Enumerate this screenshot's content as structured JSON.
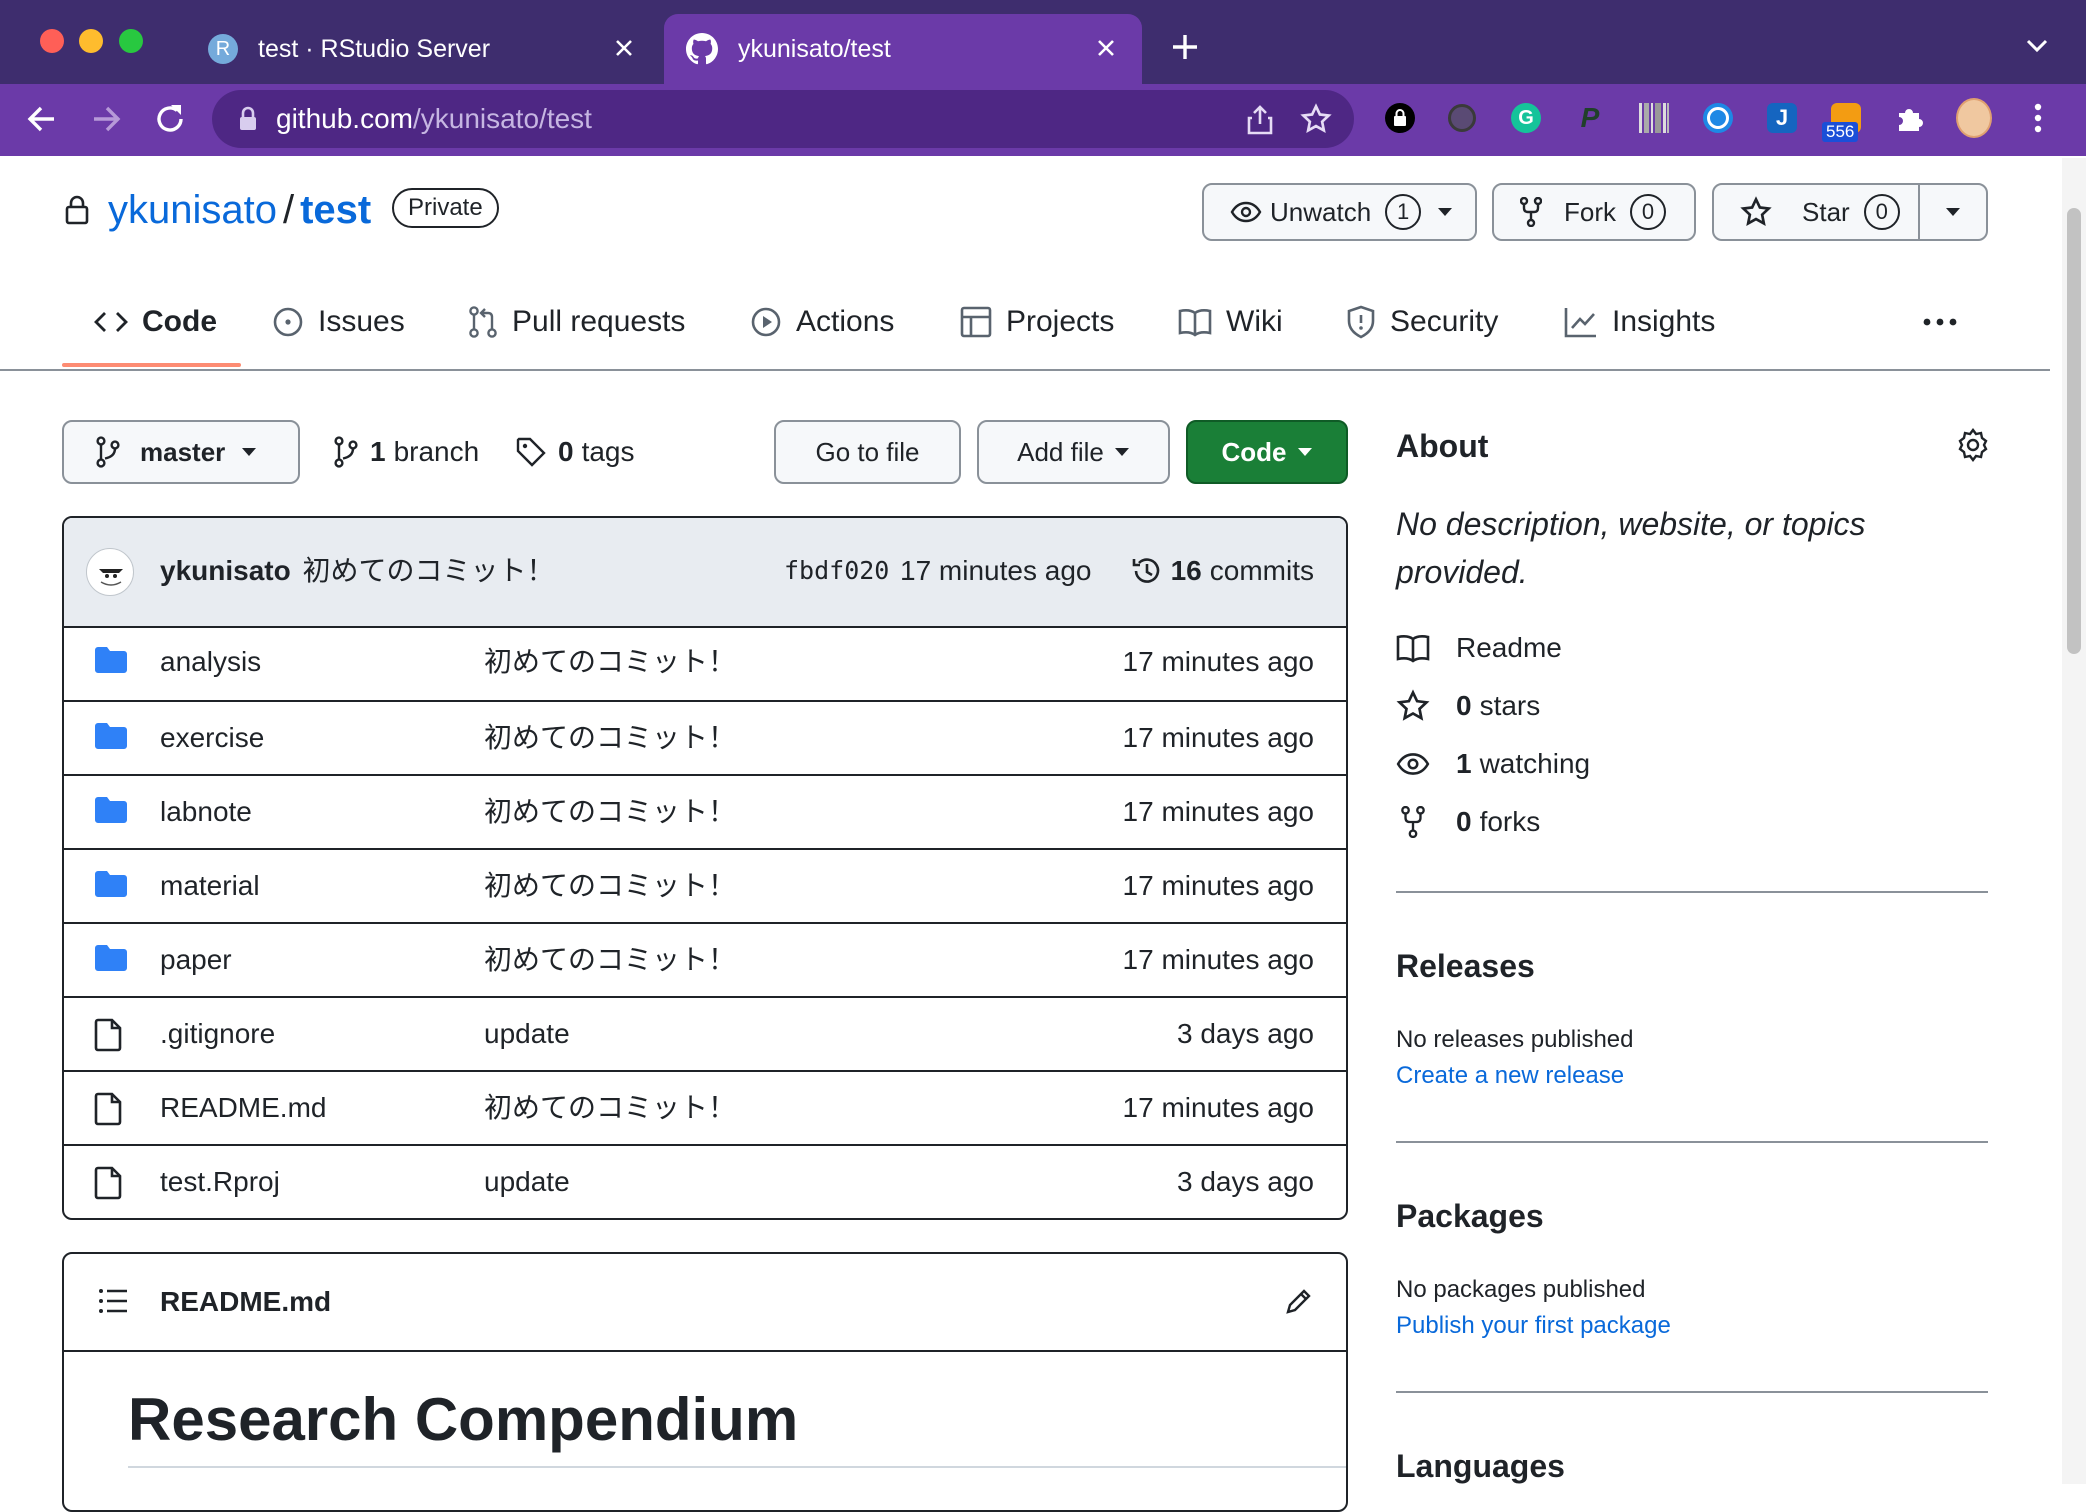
{
  "browser": {
    "tabs": [
      {
        "title": "test · RStudio Server",
        "favicon_letter": "R",
        "active": false
      },
      {
        "title": "ykunisato/test",
        "active": true
      }
    ],
    "url_domain": "github.com",
    "url_path": "/ykunisato/test",
    "extension_badge": "556"
  },
  "repo": {
    "owner": "ykunisato",
    "separator": "/",
    "name": "test",
    "visibility": "Private",
    "unwatch_label": "Unwatch",
    "watch_count": "1",
    "fork_label": "Fork",
    "fork_count": "0",
    "star_label": "Star",
    "star_count": "0"
  },
  "nav": {
    "code": "Code",
    "issues": "Issues",
    "pulls": "Pull requests",
    "actions": "Actions",
    "projects": "Projects",
    "wiki": "Wiki",
    "security": "Security",
    "insights": "Insights"
  },
  "branchbar": {
    "branch": "master",
    "branch_count": "1",
    "branch_word": "branch",
    "tag_count": "0",
    "tag_word": "tags",
    "go_to_file": "Go to file",
    "add_file": "Add file",
    "code": "Code"
  },
  "commit": {
    "author": "ykunisato",
    "message": "初めてのコミット！",
    "sha": "fbdf020",
    "time": "17 minutes ago",
    "count": "16",
    "count_word": "commits"
  },
  "files": [
    {
      "name": "analysis",
      "type": "dir",
      "message": "初めてのコミット！",
      "time": "17 minutes ago"
    },
    {
      "name": "exercise",
      "type": "dir",
      "message": "初めてのコミット！",
      "time": "17 minutes ago"
    },
    {
      "name": "labnote",
      "type": "dir",
      "message": "初めてのコミット！",
      "time": "17 minutes ago"
    },
    {
      "name": "material",
      "type": "dir",
      "message": "初めてのコミット！",
      "time": "17 minutes ago"
    },
    {
      "name": "paper",
      "type": "dir",
      "message": "初めてのコミット！",
      "time": "17 minutes ago"
    },
    {
      "name": ".gitignore",
      "type": "file",
      "message": "update",
      "time": "3 days ago"
    },
    {
      "name": "README.md",
      "type": "file",
      "message": "初めてのコミット！",
      "time": "17 minutes ago"
    },
    {
      "name": "test.Rproj",
      "type": "file",
      "message": "update",
      "time": "3 days ago"
    }
  ],
  "readme": {
    "filename": "README.md",
    "heading": "Research Compendium"
  },
  "about": {
    "title": "About",
    "description": "No description, website, or topics provided.",
    "readme": "Readme",
    "stars_count": "0",
    "stars_word": "stars",
    "watching_count": "1",
    "watching_word": "watching",
    "forks_count": "0",
    "forks_word": "forks"
  },
  "releases": {
    "title": "Releases",
    "empty": "No releases published",
    "link": "Create a new release"
  },
  "packages": {
    "title": "Packages",
    "empty": "No packages published",
    "link": "Publish your first package"
  },
  "languages": {
    "title": "Languages"
  },
  "colors": {
    "tabstrip": "#3e2d6e",
    "toolbar": "#6b3aa8",
    "link": "#0969da",
    "code_button": "#1a7f37",
    "active_tab_underline": "#fd8c73",
    "folder_icon": "#2f81f7"
  }
}
